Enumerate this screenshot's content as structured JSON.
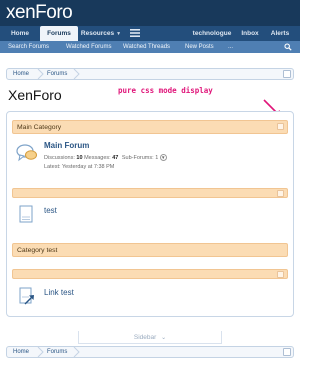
{
  "header": {
    "logo_main": "xen",
    "logo_sub": "Foro",
    "tabs": [
      {
        "label": "Home"
      },
      {
        "label": "Forums"
      },
      {
        "label": "Resources"
      },
      {
        "label": "technologue"
      },
      {
        "label": "Inbox"
      },
      {
        "label": "Alerts"
      }
    ]
  },
  "subnav": {
    "items": [
      "Search Forums",
      "Watched Forums",
      "Watched Threads",
      "New Posts",
      "..."
    ]
  },
  "breadcrumb": {
    "items": [
      "Home",
      "Forums"
    ]
  },
  "page": {
    "title": "XenForo"
  },
  "annotation": {
    "text": "pure css mode display",
    "color": "#e0167a"
  },
  "categories": [
    {
      "title": "Main Category",
      "forum": {
        "title": "Main Forum",
        "discussions_label": "Discussions:",
        "discussions_value": "10",
        "messages_label": "Messages:",
        "messages_value": "47",
        "subforums_label": "Sub-Forums:",
        "subforums_value": "1",
        "latest_label": "Latest:",
        "latest_value": "Yesterday at 7:38 PM"
      }
    },
    {
      "title": "",
      "forum": {
        "title": "test"
      }
    },
    {
      "title": "Category test"
    },
    {
      "title": "",
      "forum": {
        "title": "Link test"
      }
    }
  ],
  "sidebar": {
    "label": "Sidebar"
  },
  "colors": {
    "header_bg": "#18395b",
    "nav_bg": "#234e7c",
    "subnav_bg": "#4f7fb3",
    "category_bg": "#fbdcb4",
    "link": "#2b5685"
  }
}
